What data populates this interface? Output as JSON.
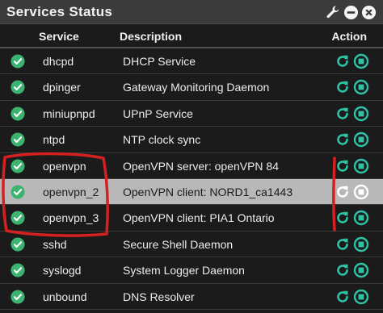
{
  "panel": {
    "title": "Services Status",
    "icons": [
      "wrench-icon",
      "minus-circle-icon",
      "close-circle-icon"
    ]
  },
  "columns": {
    "service": "Service",
    "description": "Description",
    "action": "Action"
  },
  "colors": {
    "status_ok": "#3cb371",
    "action": "#2ec3a6",
    "highlight_row": "#b8b8b8",
    "annotation": "#d42020"
  },
  "services": [
    {
      "name": "dhcpd",
      "description": "DHCP Service",
      "status": "running"
    },
    {
      "name": "dpinger",
      "description": "Gateway Monitoring Daemon",
      "status": "running"
    },
    {
      "name": "miniupnpd",
      "description": "UPnP Service",
      "status": "running"
    },
    {
      "name": "ntpd",
      "description": "NTP clock sync",
      "status": "running"
    },
    {
      "name": "openvpn",
      "description": "OpenVPN server: openVPN 84",
      "status": "running"
    },
    {
      "name": "openvpn_2",
      "description": "OpenVPN client: NORD1_ca1443",
      "status": "running",
      "highlighted": true
    },
    {
      "name": "openvpn_3",
      "description": "OpenVPN client: PIA1 Ontario",
      "status": "running"
    },
    {
      "name": "sshd",
      "description": "Secure Shell Daemon",
      "status": "running"
    },
    {
      "name": "syslogd",
      "description": "System Logger Daemon",
      "status": "running"
    },
    {
      "name": "unbound",
      "description": "DNS Resolver",
      "status": "running"
    }
  ]
}
